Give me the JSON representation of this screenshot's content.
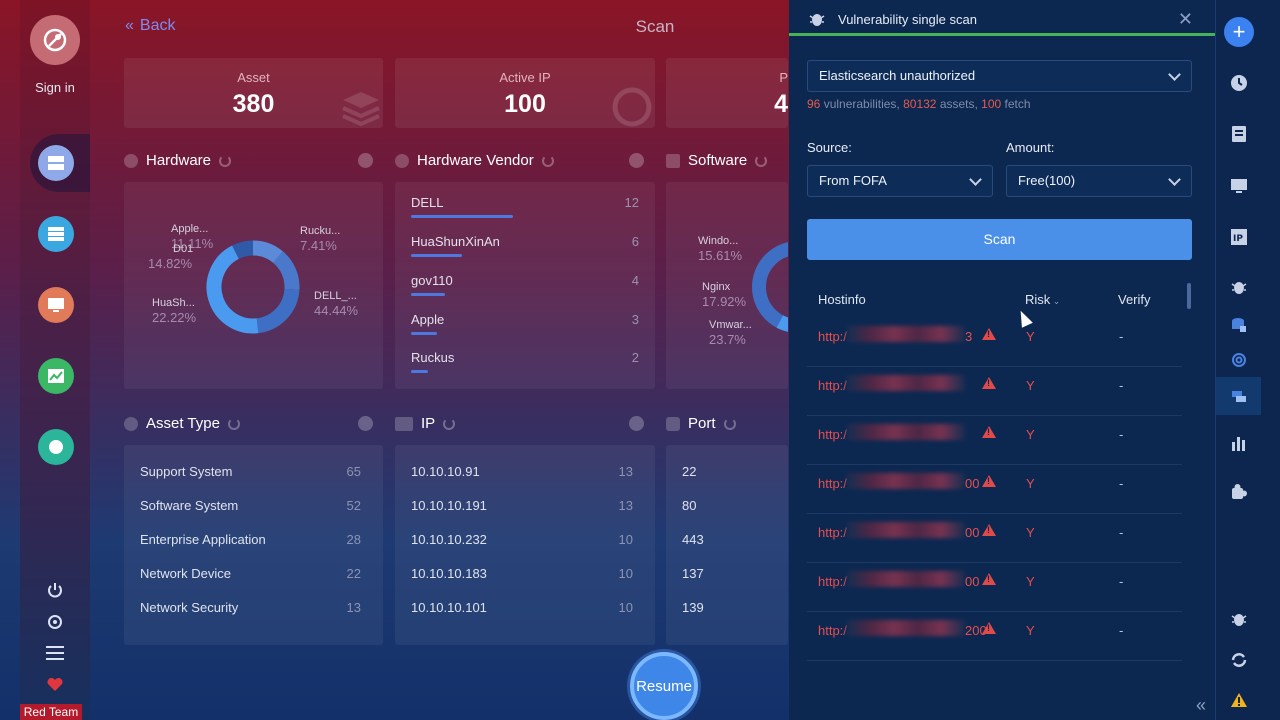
{
  "sidebar": {
    "sign_in": "Sign in",
    "red_team": "Red Team",
    "items": [
      {
        "icon": "server-icon",
        "color": "#8ea8e8"
      },
      {
        "icon": "list-icon",
        "color": "#3aa7e0"
      },
      {
        "icon": "monitor-icon",
        "color": "#e07a58"
      },
      {
        "icon": "chart-icon",
        "color": "#3ab865"
      },
      {
        "icon": "puzzle-icon",
        "color": "#2bb59a"
      }
    ]
  },
  "main": {
    "back_label": "Back",
    "title": "Scan",
    "stats": [
      {
        "label": "Asset",
        "value": "380"
      },
      {
        "label": "Active IP",
        "value": "100"
      },
      {
        "label": "P",
        "value": "4"
      }
    ],
    "hardware": {
      "title": "Hardware",
      "slices": [
        {
          "label": "Apple...",
          "pct": "11.11%",
          "value": 11.11,
          "color": "#5b8ad8"
        },
        {
          "label": "D01",
          "pct": "14.82%",
          "value": 14.82,
          "color": "#4a79cc"
        },
        {
          "label": "HuaSh...",
          "pct": "22.22%",
          "value": 22.22,
          "color": "#3f6fc4"
        },
        {
          "label": "DELL_...",
          "pct": "44.44%",
          "value": 44.44,
          "color": "#4a9af0"
        },
        {
          "label": "Rucku...",
          "pct": "7.41%",
          "value": 7.41,
          "color": "#2f5aa8"
        }
      ]
    },
    "hardware_vendor": {
      "title": "Hardware Vendor",
      "rows": [
        {
          "name": "DELL",
          "count": "12",
          "fill": 1.0
        },
        {
          "name": "HuaShunXinAn",
          "count": "6",
          "fill": 0.5
        },
        {
          "name": "gov110",
          "count": "4",
          "fill": 0.33
        },
        {
          "name": "Apple",
          "count": "3",
          "fill": 0.25
        },
        {
          "name": "Ruckus",
          "count": "2",
          "fill": 0.17
        }
      ]
    },
    "software": {
      "title": "Software",
      "slices": [
        {
          "label": "Windo...",
          "pct": "15.61%"
        },
        {
          "label": "Nginx",
          "pct": "17.92%"
        },
        {
          "label": "Vmwar...",
          "pct": "23.7%"
        }
      ]
    },
    "asset_type": {
      "title": "Asset Type",
      "rows": [
        {
          "name": "Support System",
          "count": "65"
        },
        {
          "name": "Software System",
          "count": "52"
        },
        {
          "name": "Enterprise Application",
          "count": "28"
        },
        {
          "name": "Network Device",
          "count": "22"
        },
        {
          "name": "Network Security",
          "count": "13"
        }
      ]
    },
    "ip": {
      "title": "IP",
      "rows": [
        {
          "name": "10.10.10.91",
          "count": "13"
        },
        {
          "name": "10.10.10.191",
          "count": "13"
        },
        {
          "name": "10.10.10.232",
          "count": "10"
        },
        {
          "name": "10.10.10.183",
          "count": "10"
        },
        {
          "name": "10.10.10.101",
          "count": "10"
        }
      ]
    },
    "port": {
      "title": "Port",
      "rows": [
        "22",
        "80",
        "443",
        "137",
        "139"
      ]
    },
    "resume_label": "Resume"
  },
  "scan_panel": {
    "title": "Vulnerability single scan",
    "vuln_select": "Elasticsearch unauthorized",
    "stats": {
      "vulns": "96",
      "vulns_label": "vulnerabilities,",
      "assets": "80132",
      "assets_label": "assets,",
      "fetch": "100",
      "fetch_label": "fetch"
    },
    "source_label": "Source:",
    "source_value": "From FOFA",
    "amount_label": "Amount:",
    "amount_value": "Free(100)",
    "scan_button": "Scan",
    "columns": {
      "host": "Hostinfo",
      "risk": "Risk",
      "verify": "Verify"
    },
    "rows": [
      {
        "prefix": "http:/",
        "suffix": "3",
        "risk": "Y",
        "verify": "-"
      },
      {
        "prefix": "http:/",
        "suffix": "",
        "risk": "Y",
        "verify": "-"
      },
      {
        "prefix": "http:/",
        "suffix": "",
        "risk": "Y",
        "verify": "-"
      },
      {
        "prefix": "http:/",
        "suffix": "00",
        "risk": "Y",
        "verify": "-"
      },
      {
        "prefix": "http:/",
        "suffix": "00",
        "risk": "Y",
        "verify": "-"
      },
      {
        "prefix": "http:/",
        "suffix": "00",
        "risk": "Y",
        "verify": "-"
      },
      {
        "prefix": "http:/",
        "suffix": "200",
        "risk": "Y",
        "verify": "-"
      }
    ]
  },
  "toolbar": {
    "items": [
      "plus-icon",
      "clock-icon",
      "document-icon",
      "monitor-icon",
      "ip-icon",
      "bug-icon",
      "database-lock-icon",
      "fingerprint-icon",
      "layers-icon",
      "bar-chart-icon",
      "puzzle-icon",
      "bug-icon",
      "refresh-icon",
      "warning-icon"
    ]
  }
}
